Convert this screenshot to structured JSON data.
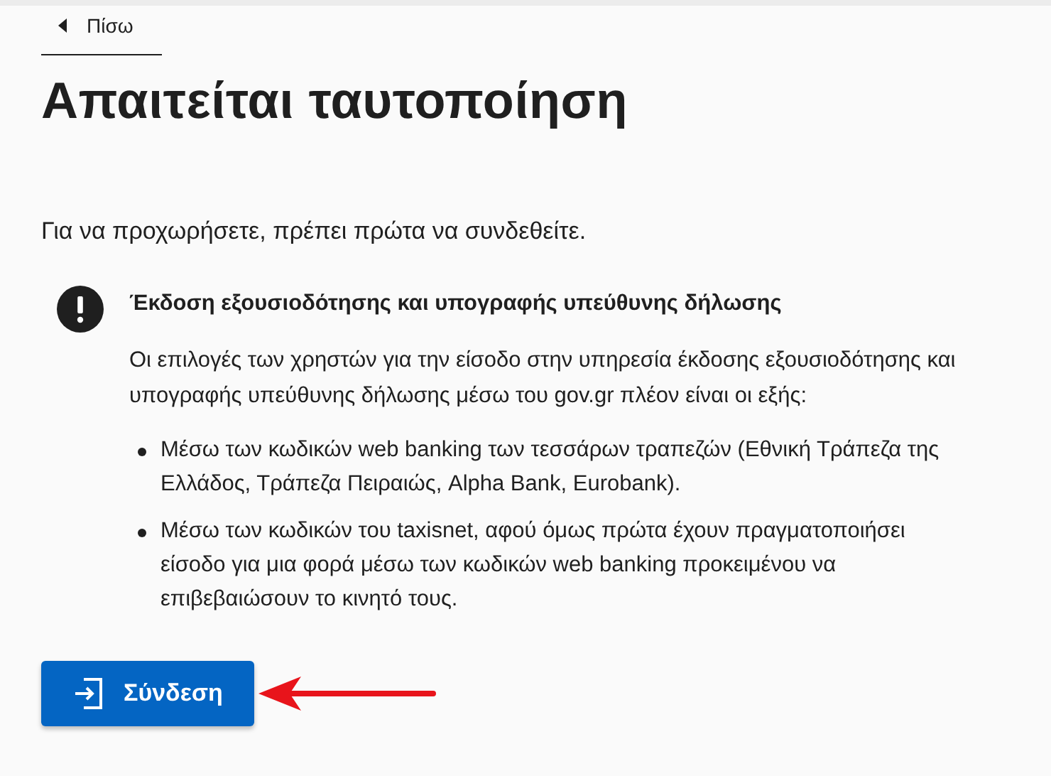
{
  "back_link": {
    "label": "Πίσω"
  },
  "title": "Απαιτείται ταυτοποίηση",
  "intro": "Για να προχωρήσετε, πρέπει πρώτα να συνδεθείτε.",
  "notice": {
    "heading": "Έκδοση εξουσιοδότησης και υπογραφής υπεύθυνης δήλωσης",
    "text": "Οι επιλογές των χρηστών για την είσοδο στην υπηρεσία έκδοσης εξουσιοδότησης και υπογραφής υπεύθυνης δήλωσης μέσω του gov.gr πλέον είναι οι εξής:",
    "items": [
      "Μέσω των κωδικών web banking των τεσσάρων τραπεζών (Εθνική Τράπεζα της Ελλάδος, Τράπεζα Πειραιώς, Alpha Bank, Eurobank).",
      "Μέσω των κωδικών του taxisnet, αφού όμως πρώτα έχουν πραγματοποιήσει είσοδο για μια φορά μέσω των κωδικών web banking προκειμένου να επιβεβαιώσουν το κινητό τους."
    ]
  },
  "login_button": {
    "label": "Σύνδεση"
  }
}
